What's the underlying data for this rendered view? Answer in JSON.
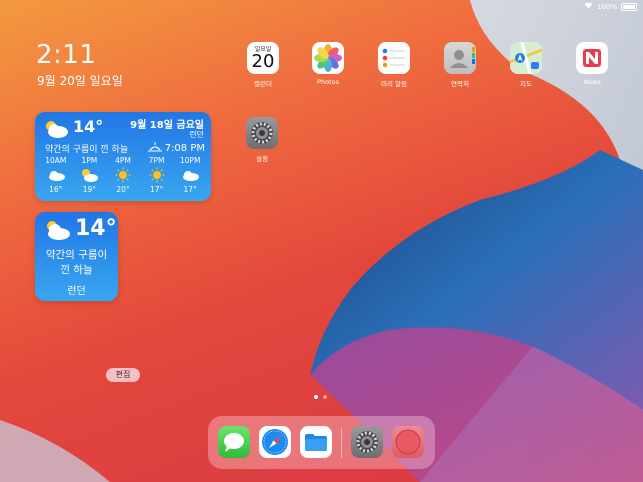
{
  "status_bar": {
    "battery_text": "100%"
  },
  "lock": {
    "time": "2:11",
    "date": "9월 20일 일요일"
  },
  "weather_large": {
    "temp": "14°",
    "date": "9월 18일 금요일",
    "city": "런던",
    "condition": "약간의 구름이 낀 하늘",
    "sunset": "7:08 PM",
    "hours": [
      {
        "time": "10AM",
        "icon": "cloud-icon",
        "temp": "16°"
      },
      {
        "time": "1PM",
        "icon": "sun-cloud-icon",
        "temp": "19°"
      },
      {
        "time": "4PM",
        "icon": "sun-icon",
        "temp": "20°"
      },
      {
        "time": "7PM",
        "icon": "sun-icon",
        "temp": "17°"
      },
      {
        "time": "10PM",
        "icon": "cloud-icon",
        "temp": "17°"
      }
    ]
  },
  "weather_small": {
    "temp": "14°",
    "condition_line1": "약간의 구름이",
    "condition_line2": "낀 하늘",
    "city": "런던"
  },
  "apps": {
    "calendar": {
      "label": "캘린더",
      "weekday": "일요일",
      "day": "20"
    },
    "photos": {
      "label": "Photos"
    },
    "reminders": {
      "label": "미리 알림"
    },
    "contacts": {
      "label": "연락처"
    },
    "maps": {
      "label": "지도"
    },
    "news": {
      "label": "News"
    },
    "settings": {
      "label": "설정"
    }
  },
  "edit_button": "편집",
  "page_dots": {
    "count": 2,
    "active": 1
  },
  "dock": [
    "Messages",
    "Safari",
    "Files",
    "Settings",
    "Recent"
  ],
  "colors": {
    "weather_blue": "#2f93ec",
    "edit_pink": "#f7c1c4"
  }
}
